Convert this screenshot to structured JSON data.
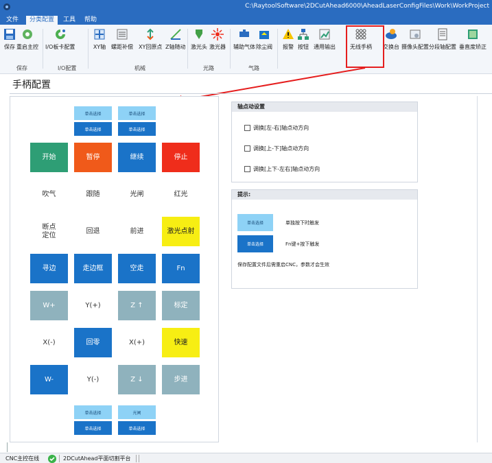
{
  "titlebar": {
    "path": "C:\\RaytoolSoftware\\2DCutAhead6000\\AheadLaserConfigFiles\\Work\\WorkProject"
  },
  "menu": {
    "file": "文件",
    "category_config": "分类配置",
    "tools": "工具",
    "help": "帮助"
  },
  "ribbon": {
    "buttons": [
      "保存",
      "重启主控",
      "I/O板卡配置",
      "XY轴",
      "螺距补偿",
      "XY回原点",
      "Z轴随动",
      "激光头",
      "激光器",
      "辅助气体",
      "除尘阀",
      "报警",
      "按钮",
      "通用输出",
      "无线手柄",
      "交换台",
      "摄像头配置",
      "分段轴配置",
      "垂直度矫正"
    ],
    "groups": [
      "保存",
      "I/O配置",
      "机械",
      "光路",
      "气路"
    ]
  },
  "page_title": "手柄配置",
  "handle": {
    "top_select": [
      "单击选择",
      "单击选择",
      "单击选择",
      "单击选择"
    ],
    "rows": [
      [
        "开始",
        "暂停",
        "继续",
        "停止"
      ],
      [
        "吹气",
        "跟随",
        "光闸",
        "红光"
      ],
      [
        "断点\n定位",
        "回退",
        "前进",
        "激光点射"
      ],
      [
        "寻边",
        "走边框",
        "空走",
        "Fn"
      ],
      [
        "W+",
        "Y(+)",
        "Z ↑",
        "标定"
      ],
      [
        "X(-)",
        "回零",
        "X(+)",
        "快速"
      ],
      [
        "W-",
        "Y(-)",
        "Z ↓",
        "步进"
      ]
    ],
    "bottom_select": [
      "单击选择",
      "光闸",
      "单击选择",
      "单击选择"
    ],
    "colors": {
      "blue": "#1a73c8",
      "green": "#2e9e75",
      "orange": "#f05a1a",
      "red": "#ef2d1b",
      "yellow": "#f7ee13",
      "gray": "#8fb2bd",
      "light_blue": "#8ed2f6"
    }
  },
  "axis_settings": {
    "title": "轴点动设置",
    "options": [
      "调换[左-右]轴点动方向",
      "调换[上-下]轴点动方向",
      "调换[上下-左右]轴点动方向"
    ]
  },
  "hint_box": {
    "title": "提示:",
    "light_button": "单击选择",
    "light_desc": "单独按下时触发",
    "dark_button": "单击选择",
    "dark_desc": "Fn键+按下触发",
    "note": "保存配置文件后需重启CNC，参数才会生效"
  },
  "status": {
    "cnc": "CNC主控在线",
    "platform": "2DCutAhead平面切割平台"
  }
}
